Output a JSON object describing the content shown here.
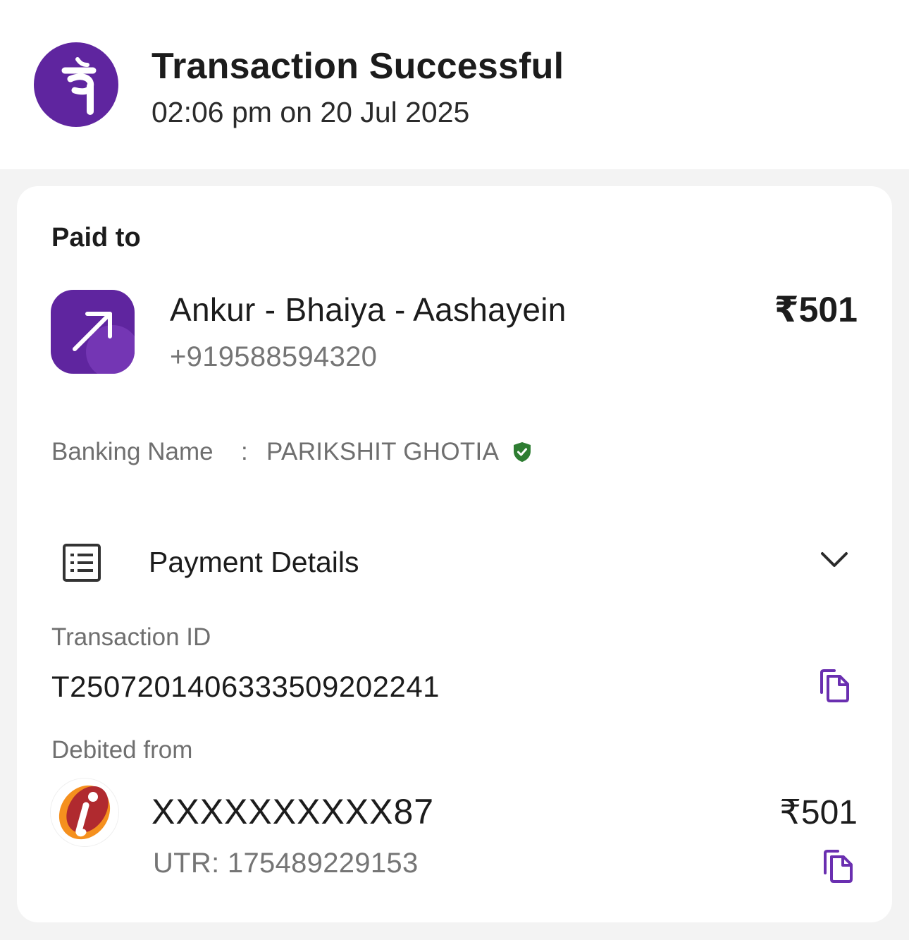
{
  "header": {
    "logo_icon": "phonepe-logo-icon",
    "logo_glyph": "पे",
    "title": "Transaction Successful",
    "datetime": "02:06 pm on 20 Jul 2025"
  },
  "paid_to": {
    "label": "Paid to",
    "icon": "arrow-up-right-icon",
    "name": "Ankur - Bhaiya - Aashayein",
    "phone": "+919588594320",
    "amount": "₹501"
  },
  "banking": {
    "label": "Banking Name",
    "separator": ":",
    "name": "PARIKSHIT GHOTIA",
    "verified_icon": "verified-shield-icon"
  },
  "payment_details": {
    "label": "Payment Details",
    "icon": "receipt-list-icon",
    "toggle_icon": "chevron-down-icon",
    "transaction_id_label": "Transaction ID",
    "transaction_id": "T2507201406333509202241",
    "debited_from_label": "Debited from",
    "account": "XXXXXXXXXX87",
    "utr": "UTR: 175489229153",
    "debit_amount": "₹501",
    "bank_logo_icon": "icici-bank-logo-icon"
  },
  "colors": {
    "brand": "#5f259f",
    "copy_icon": "#6a2fb0",
    "verified": "#2e7d32",
    "background": "#f3f3f3",
    "muted_text": "#6f6f6f"
  }
}
